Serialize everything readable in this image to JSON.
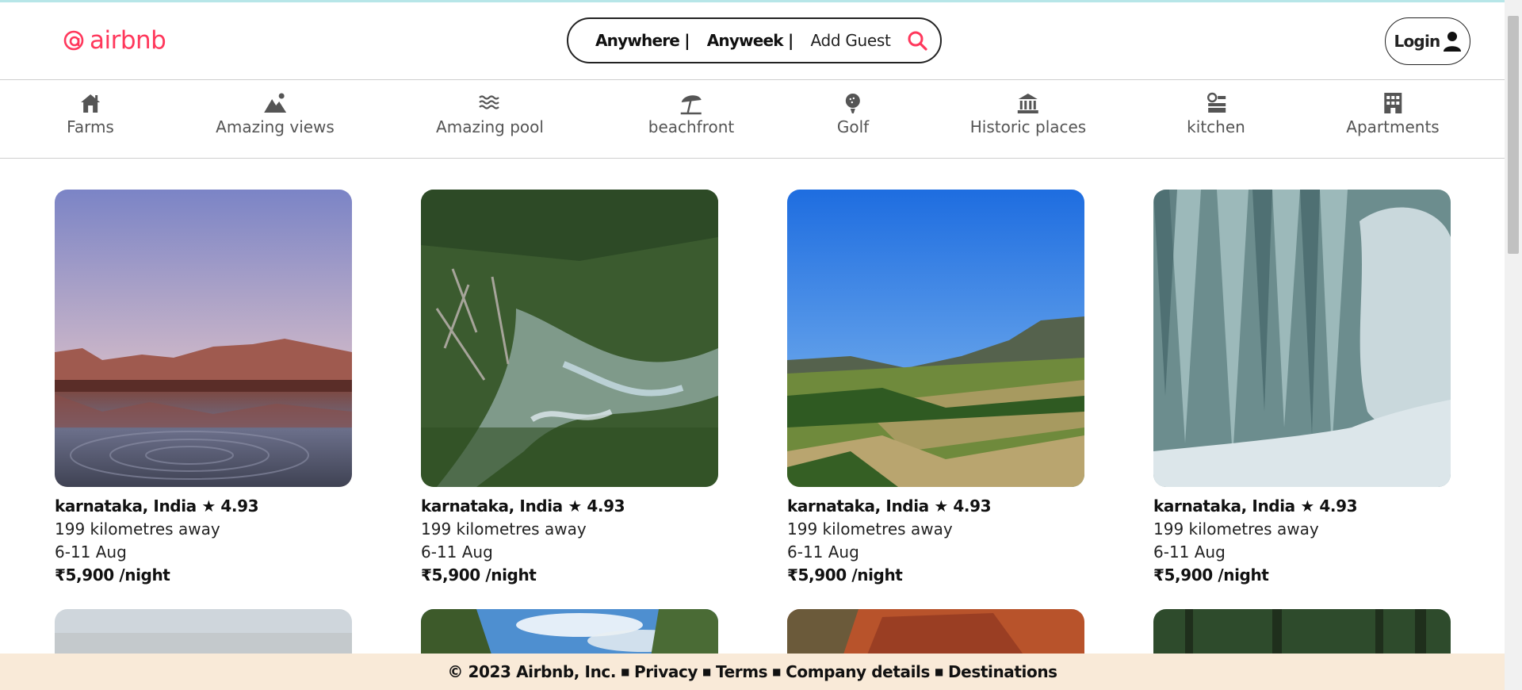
{
  "brand": {
    "name": "airbnb",
    "color": "#ff385c"
  },
  "search": {
    "anywhere": "Anywhere |",
    "anyweek": "Anyweek |",
    "add_guest": "Add Guest",
    "icon": "search-icon"
  },
  "login": {
    "label": "Login",
    "icon": "user-icon"
  },
  "categories": [
    {
      "label": "Farms",
      "icon": "farm-house-icon"
    },
    {
      "label": "Amazing views",
      "icon": "mountain-view-icon"
    },
    {
      "label": "Amazing pool",
      "icon": "pool-waves-icon"
    },
    {
      "label": "beachfront",
      "icon": "beach-umbrella-icon"
    },
    {
      "label": "Golf",
      "icon": "golf-ball-icon"
    },
    {
      "label": "Historic places",
      "icon": "landmark-icon"
    },
    {
      "label": "kitchen",
      "icon": "kitchen-icon"
    },
    {
      "label": "Apartments",
      "icon": "building-icon"
    }
  ],
  "listings": [
    {
      "location": "karnataka, India ★ 4.93",
      "distance": "199 kilometres away",
      "dates": "6-11 Aug",
      "price": "₹5,900 /night",
      "image": "mountain-lake-photo"
    },
    {
      "location": "karnataka, India ★ 4.93",
      "distance": "199 kilometres away",
      "dates": "6-11 Aug",
      "price": "₹5,900 /night",
      "image": "river-forest-photo"
    },
    {
      "location": "karnataka, India ★ 4.93",
      "distance": "199 kilometres away",
      "dates": "6-11 Aug",
      "price": "₹5,900 /night",
      "image": "green-valley-photo"
    },
    {
      "location": "karnataka, India ★ 4.93",
      "distance": "199 kilometres away",
      "dates": "6-11 Aug",
      "price": "₹5,900 /night",
      "image": "frozen-waterfall-photo"
    }
  ],
  "footer": {
    "copyright": "© 2023 Airbnb, Inc.",
    "links": [
      "Privacy",
      "Terms",
      "Company details",
      "Destinations"
    ]
  }
}
